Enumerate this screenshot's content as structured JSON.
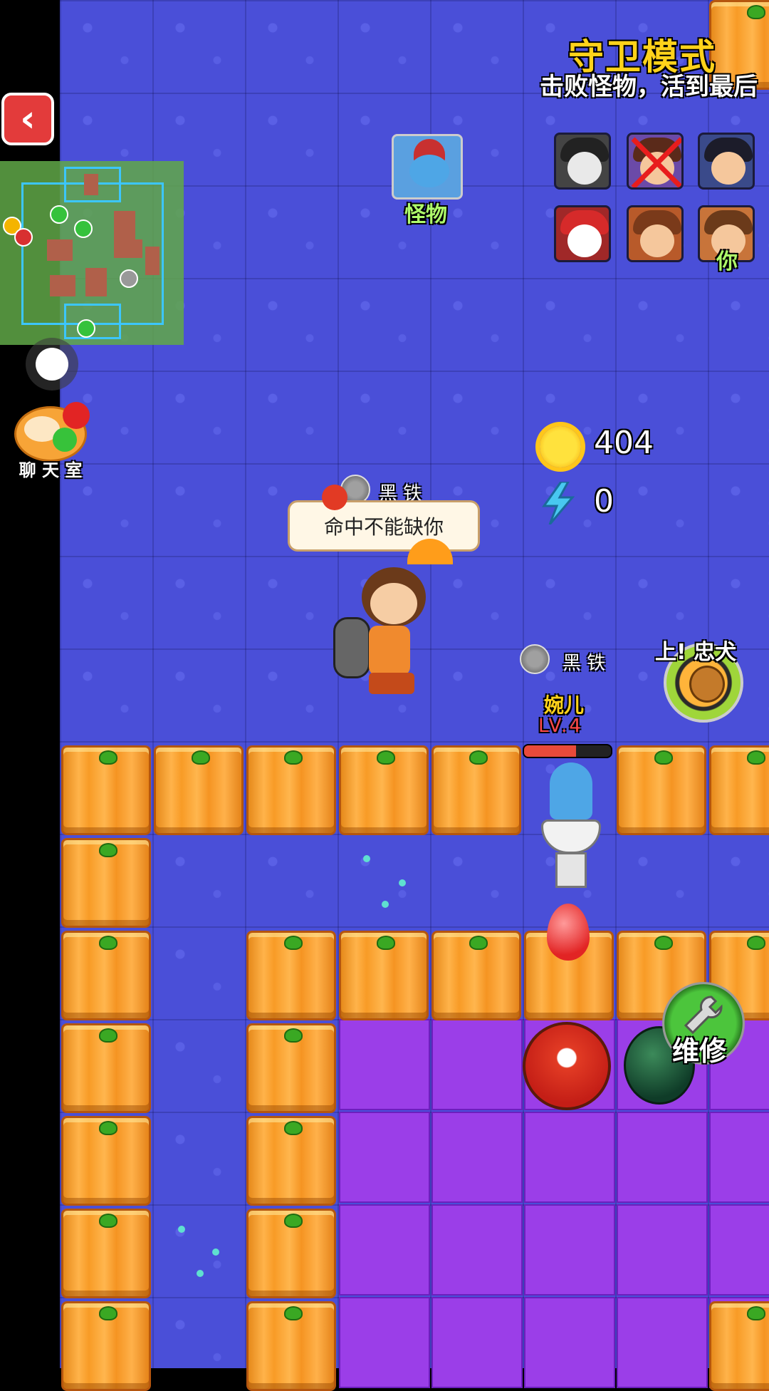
{
  "header": {
    "mode_title": "守卫模式",
    "mode_subtitle": "击败怪物，活到最后"
  },
  "controls": {
    "back_icon": "chevron-left-icon",
    "chat_label": "聊 天 室"
  },
  "monster_panel": {
    "label": "怪物"
  },
  "players": {
    "you_label": "你",
    "portraits": [
      "robot",
      "girl-eliminated",
      "warrior",
      "santa",
      "knight",
      "you-girl"
    ]
  },
  "resources": {
    "gold": "404",
    "energy": "0"
  },
  "hero": {
    "rank": "黑 铁",
    "speech": "命中不能缺你"
  },
  "ally": {
    "rank": "黑 铁",
    "name": "婉儿",
    "level": "LV.4",
    "hp_fraction": 0.6
  },
  "skills": {
    "dog_label": "上! 忠犬",
    "repair_label": "维修"
  },
  "colors": {
    "field": "#4a4fd8",
    "tile": "#f89b26",
    "purple": "#9b3ee8",
    "title": "#ffd21a",
    "label_green": "#aefc6a"
  }
}
